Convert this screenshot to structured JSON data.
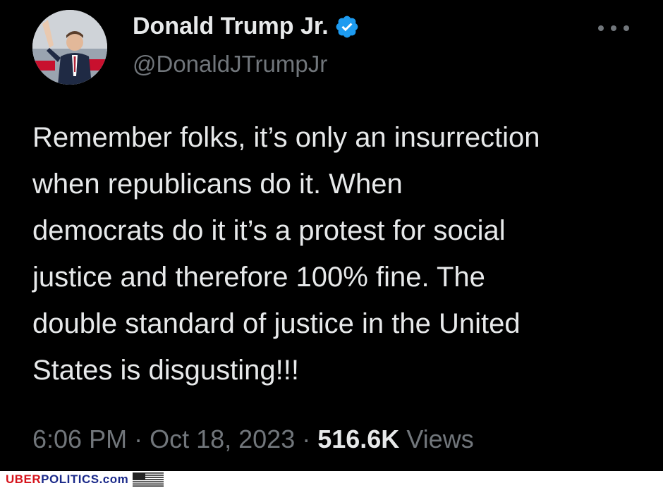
{
  "author": {
    "display_name": "Donald Trump Jr.",
    "handle": "@DonaldJTrumpJr",
    "verified": true,
    "avatar_icon": "profile-photo"
  },
  "tweet": {
    "lines": [
      "Remember folks, it’s only an insurrection",
      "when republicans do it. When",
      "democrats do it it’s a protest for social",
      "justice and therefore 100% fine. The",
      "double standard of justice in the United",
      "States is disgusting!!!"
    ]
  },
  "meta": {
    "time": "6:06 PM",
    "sep1": " · ",
    "date": "Oct 18, 2023",
    "sep2": " · ",
    "views_count": "516.6K",
    "views_label": " Views"
  },
  "watermark": {
    "part1": "UBER",
    "part2": "POLITICS",
    "part3": ".com"
  },
  "colors": {
    "background": "#000000",
    "text": "#e7e9ea",
    "muted": "#71767b",
    "verified_badge": "#1d9bf0"
  }
}
